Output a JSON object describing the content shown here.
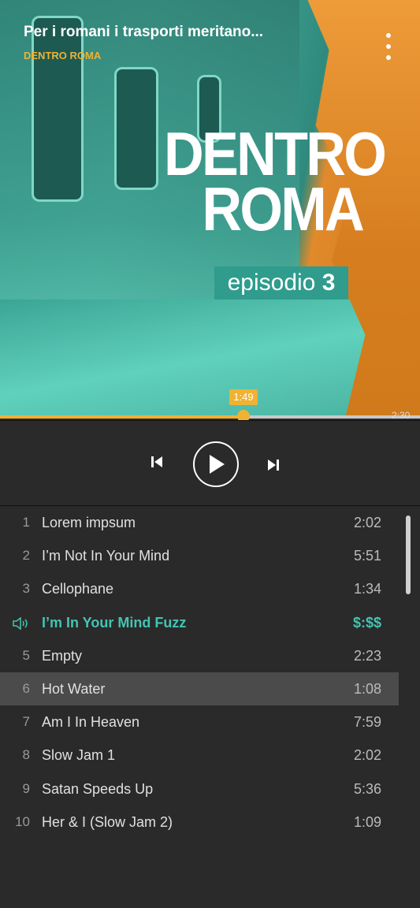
{
  "header": {
    "title": "Per i romani i trasporti meritano...",
    "subtitle": "DENTRO ROMA"
  },
  "artwork": {
    "line1": "DENTRO",
    "line2": "ROMA",
    "episode_word": "episodio",
    "episode_number": "3"
  },
  "player": {
    "current_time": "1:49",
    "duration": "2:30",
    "progress": 0.58,
    "colors": {
      "accent": "#f0b233",
      "active_track": "#44c4b1"
    }
  },
  "controls": {
    "prev_icon": "skip-previous-icon",
    "play_icon": "play-icon",
    "next_icon": "skip-next-icon"
  },
  "playlist": {
    "tracks": [
      {
        "num": "1",
        "name": "Lorem impsum",
        "dur": "2:02"
      },
      {
        "num": "2",
        "name": "I’m Not In Your Mind",
        "dur": "5:51"
      },
      {
        "num": "3",
        "name": "Cellophane",
        "dur": "1:34"
      },
      {
        "num": "",
        "name": "I’m In Your Mind Fuzz",
        "dur": "$:$$",
        "active": true
      },
      {
        "num": "5",
        "name": "Empty",
        "dur": "2:23"
      },
      {
        "num": "6",
        "name": "Hot Water",
        "dur": "1:08",
        "hover": true
      },
      {
        "num": "7",
        "name": "Am I In Heaven",
        "dur": "7:59"
      },
      {
        "num": "8",
        "name": "Slow Jam 1",
        "dur": "2:02"
      },
      {
        "num": "9",
        "name": "Satan Speeds Up",
        "dur": "5:36"
      },
      {
        "num": "10",
        "name": "Her & I (Slow Jam 2)",
        "dur": "1:09"
      }
    ]
  }
}
